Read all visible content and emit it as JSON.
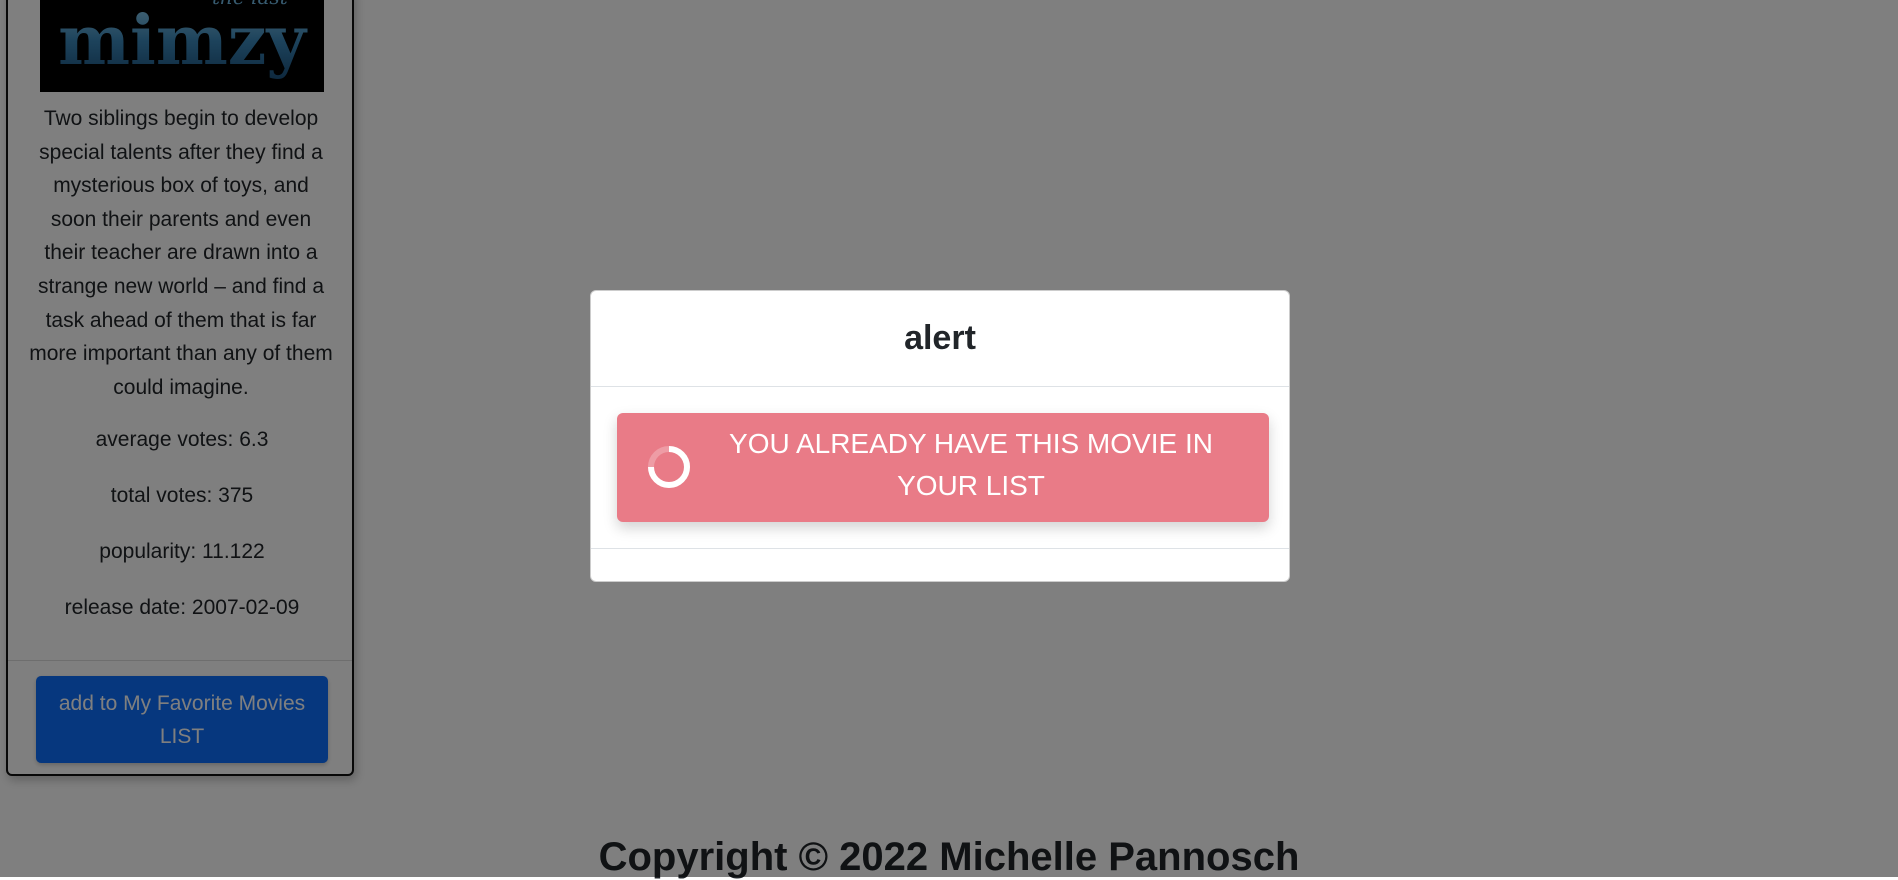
{
  "movie_card": {
    "poster": {
      "logo_small": "the last",
      "logo_main": "mimzy"
    },
    "overview": "Two siblings begin to develop special talents after they find a mysterious box of toys, and soon their parents and even their teacher are drawn into a strange new world – and find a task ahead of them that is far more important than any of them could imagine.",
    "stats": {
      "average_votes": "average votes: 6.3",
      "total_votes": "total votes: 375",
      "popularity": "popularity: 11.122",
      "release_date": "release date: 2007-02-09"
    },
    "favorite_button_label": "add to My Favorite Movies LIST"
  },
  "footer": {
    "copyright": "Copyright © 2022 Michelle Pannosch"
  },
  "modal": {
    "title": "alert",
    "alert_message": "YOU ALREADY HAVE THIS MOVIE IN YOUR LIST",
    "spinner_icon": "loading-spinner-icon"
  },
  "colors": {
    "backdrop": "rgba(0,0,0,0.5)",
    "alert_background": "#e97b87",
    "button_primary": "#0d6efd"
  }
}
